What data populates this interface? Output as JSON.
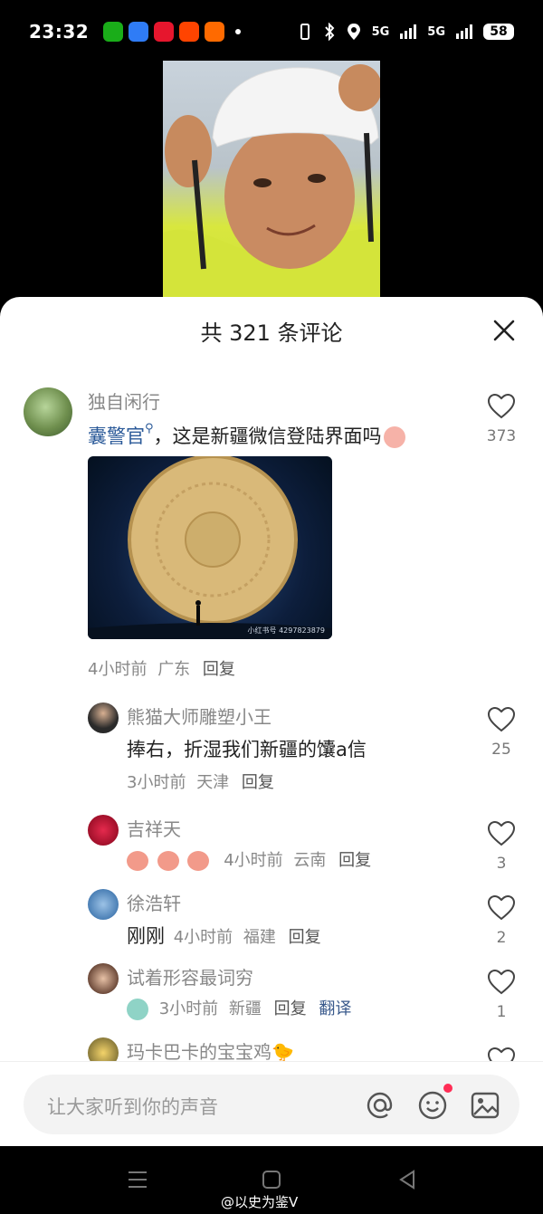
{
  "status_bar": {
    "time": "23:32",
    "network_1": "5G",
    "network_2": "5G",
    "battery": "58"
  },
  "sheet": {
    "title": "共 321 条评论"
  },
  "comments": [
    {
      "username": "独自闲行",
      "mention": "囊警官",
      "text": "，这是新疆微信登陆界面吗",
      "meta_time": "4小时前",
      "meta_location": "广东",
      "reply_label": "回复",
      "likes": "373",
      "image_watermark": "小红书号 4297823879"
    },
    {
      "username": "熊猫大师雕塑小王",
      "text": "捧右，折湿我们新疆的馕a信",
      "meta_time": "3小时前",
      "meta_location": "天津",
      "reply_label": "回复",
      "likes": "25"
    },
    {
      "username": "吉祥天",
      "text": "",
      "meta_time": "4小时前",
      "meta_location": "云南",
      "reply_label": "回复",
      "likes": "3"
    },
    {
      "username": "徐浩轩",
      "text": "刚刚",
      "meta_time": "4小时前",
      "meta_location": "福建",
      "reply_label": "回复",
      "likes": "2"
    },
    {
      "username": "试着形容最词穷",
      "meta_time": "3小时前",
      "meta_location": "新疆",
      "reply_label": "回复",
      "translate_label": "翻译",
      "likes": "1"
    },
    {
      "username": "玛卡巴卡的宝宝鸡🐤"
    }
  ],
  "input": {
    "placeholder": "让大家听到你的声音"
  },
  "watermark": "@以史为鉴V",
  "colors": {
    "mention": "#2b5a99",
    "notification_dot": "#ff2d55"
  }
}
